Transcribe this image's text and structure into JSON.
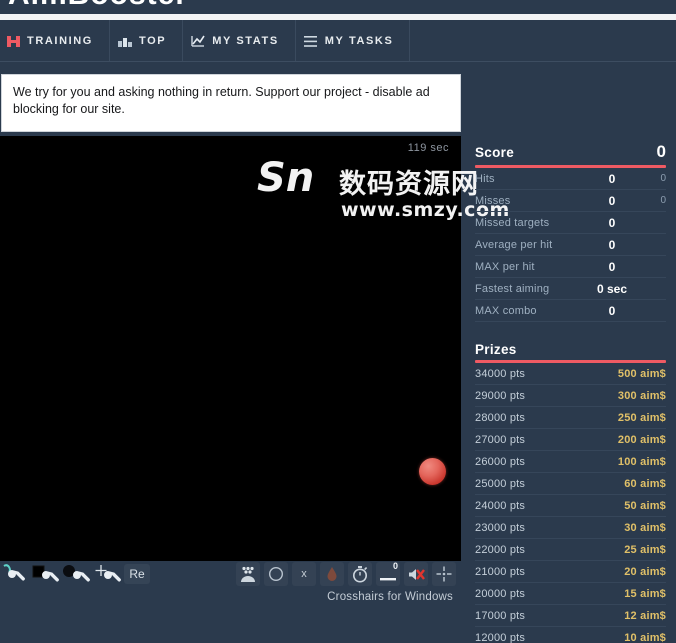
{
  "brand": {
    "logo_text_cut": "AimBooster",
    "accent_color": "#ef5a63"
  },
  "nav": {
    "items": [
      {
        "label": "TRAINING",
        "icon": "flag-icon",
        "active": true
      },
      {
        "label": "TOP",
        "icon": "podium-icon",
        "active": false
      },
      {
        "label": "MY STATS",
        "icon": "line-chart-icon",
        "active": false
      },
      {
        "label": "MY TASKS",
        "icon": "list-icon",
        "active": false
      }
    ]
  },
  "ad_notice": {
    "text": "We try for you and asking nothing in return. Support our project - disable ad blocking for our site."
  },
  "game": {
    "timer": "119 sec",
    "target_color": "#e4665c",
    "background": "#000000"
  },
  "watermark": {
    "logo": "Sn",
    "chinese": "数码资源网",
    "url": "www.smzy.com"
  },
  "toolbar": {
    "left": [
      {
        "icon": "wrench-settings-icon",
        "label": ""
      },
      {
        "icon": "wrench-square-target-icon",
        "label": ""
      },
      {
        "icon": "wrench-round-target-icon",
        "label": ""
      },
      {
        "icon": "wrench-crosshair-icon",
        "label": ""
      },
      {
        "icon": "reset-icon",
        "label": "Re"
      }
    ],
    "right": [
      {
        "icon": "targets-count-icon",
        "label": ""
      },
      {
        "icon": "circle-shape-icon",
        "label": ""
      },
      {
        "icon": "close-x-icon",
        "label": "x"
      },
      {
        "icon": "blood-drop-icon",
        "label": ""
      },
      {
        "icon": "stopwatch-icon",
        "label": ""
      },
      {
        "icon": "volume-slider-icon",
        "label": "0"
      },
      {
        "icon": "mute-speaker-icon",
        "label": ""
      },
      {
        "icon": "crosshair-icon",
        "label": ""
      }
    ],
    "crosshair_label": "Crosshairs for Windows"
  },
  "score_panel": {
    "title": "Score",
    "value": "0",
    "rows": [
      {
        "label": "Hits",
        "value": "0",
        "sub": "0"
      },
      {
        "label": "Misses",
        "value": "0",
        "sub": "0"
      },
      {
        "label": "Missed targets",
        "value": "0",
        "sub": ""
      },
      {
        "label": "Average per hit",
        "value": "0",
        "sub": ""
      },
      {
        "label": "MAX per hit",
        "value": "0",
        "sub": ""
      },
      {
        "label": "Fastest aiming",
        "value": "0 sec",
        "sub": ""
      },
      {
        "label": "MAX combo",
        "value": "0",
        "sub": ""
      }
    ]
  },
  "prizes_panel": {
    "title": "Prizes",
    "unit": "aim$",
    "rows": [
      {
        "pts": "34000 pts",
        "amount": "500"
      },
      {
        "pts": "29000 pts",
        "amount": "300"
      },
      {
        "pts": "28000 pts",
        "amount": "250"
      },
      {
        "pts": "27000 pts",
        "amount": "200"
      },
      {
        "pts": "26000 pts",
        "amount": "100"
      },
      {
        "pts": "25000 pts",
        "amount": "60"
      },
      {
        "pts": "24000 pts",
        "amount": "50"
      },
      {
        "pts": "23000 pts",
        "amount": "30"
      },
      {
        "pts": "22000 pts",
        "amount": "25"
      },
      {
        "pts": "21000 pts",
        "amount": "20"
      },
      {
        "pts": "20000 pts",
        "amount": "15"
      },
      {
        "pts": "17000 pts",
        "amount": "12"
      },
      {
        "pts": "12000 pts",
        "amount": "10"
      }
    ]
  }
}
